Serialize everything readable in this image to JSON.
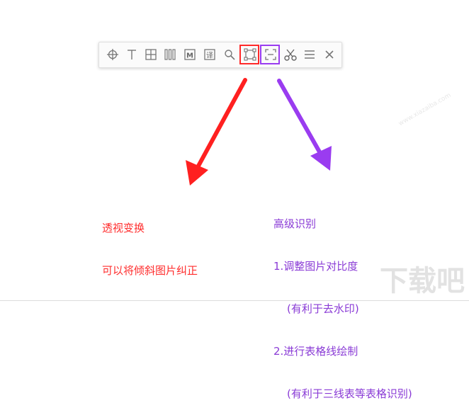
{
  "toolbar": {
    "buttons": [
      {
        "icon": "crosshair-icon"
      },
      {
        "icon": "text-cursor-icon"
      },
      {
        "icon": "table-grid-icon"
      },
      {
        "icon": "columns-icon"
      },
      {
        "icon": "m-box-icon",
        "label": "M"
      },
      {
        "icon": "translate-icon",
        "label": "译"
      },
      {
        "icon": "search-icon"
      },
      {
        "icon": "perspective-transform-icon"
      },
      {
        "icon": "advanced-recognize-icon"
      },
      {
        "icon": "scissors-icon"
      },
      {
        "icon": "menu-icon"
      },
      {
        "icon": "close-icon"
      }
    ]
  },
  "highlight_colors": {
    "red": "#ff2a2a",
    "purple": "#9a3cf0"
  },
  "annotations": {
    "left": {
      "title": "透视变换",
      "desc": "可以将倾斜图片纠正",
      "color": "#ff2d2d"
    },
    "right": {
      "title": "高级识别",
      "item1": "1.调整图片对比度",
      "item1_note": "(有利于去水印)",
      "item2": "2.进行表格线绘制",
      "item2_note": "(有利于三线表等表格识别)",
      "color": "#8a3bd6"
    }
  },
  "watermark": {
    "url": "www.xiazaiba.com",
    "logo_text": "下载吧"
  }
}
